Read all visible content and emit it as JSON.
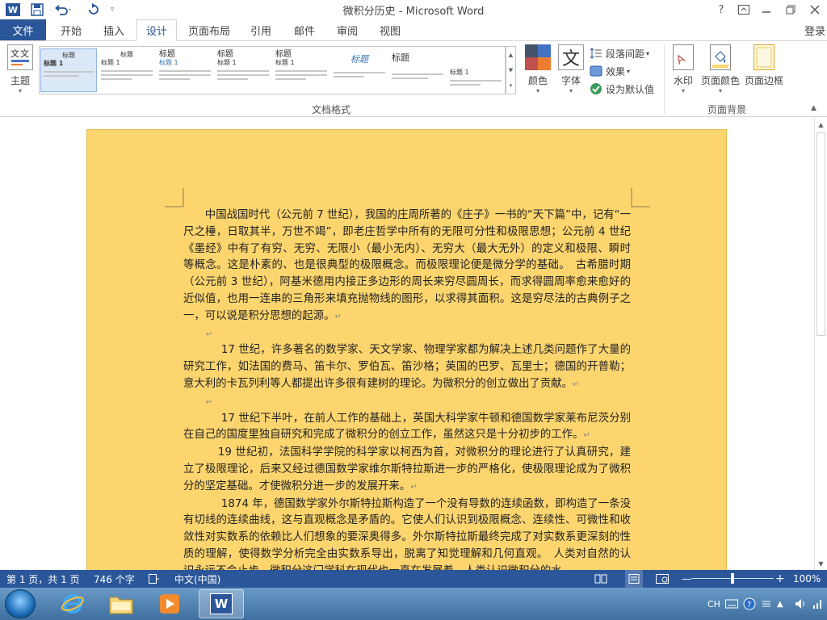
{
  "window": {
    "title": "微积分历史 - Microsoft Word",
    "controls": {
      "help": "?",
      "restore_ribbon": "⊡",
      "minimize": "—",
      "restore": "⧉",
      "close": "✕"
    }
  },
  "quick_access": {
    "app_icon": "W",
    "save_icon": "save-icon",
    "undo_icon": "undo-icon",
    "redo_icon": "redo-icon",
    "customize_icon": "customize-icon"
  },
  "ribbon": {
    "file_tab": "文件",
    "tabs": [
      "开始",
      "插入",
      "设计",
      "页面布局",
      "引用",
      "邮件",
      "审阅",
      "视图"
    ],
    "active_tab": "设计",
    "login": "登录",
    "groups": {
      "document_formatting": {
        "label": "文档格式",
        "theme_label": "主题",
        "styles": [
          {
            "title": "标题",
            "subtitle": "标题 1"
          },
          {
            "title": "标题",
            "subtitle": "标题 1"
          },
          {
            "title": "标题",
            "subtitle": "标题 1"
          },
          {
            "title": "标题",
            "subtitle": "标题 1"
          },
          {
            "title": "标题",
            "subtitle": "标题 1"
          },
          {
            "title": "标题",
            "subtitle": ""
          },
          {
            "title": "标题",
            "subtitle": ""
          },
          {
            "title": "",
            "subtitle": "标题 1"
          },
          {
            "title": "标题",
            "subtitle": ""
          }
        ],
        "colors_label": "颜色",
        "fonts_label": "字体",
        "fonts_glyph": "文",
        "paragraph_spacing_label": "段落间距",
        "effects_label": "效果",
        "set_default_label": "设为默认值"
      },
      "page_background": {
        "label": "页面背景",
        "watermark_label": "水印",
        "page_color_label": "页面颜色",
        "page_borders_label": "页面边框"
      }
    }
  },
  "document": {
    "page_color": "#fdd56e",
    "paragraphs": [
      {
        "text": "中国战国时代（公元前 7 世纪），我国的庄周所著的《庄子》一书的“天下篇”中，记有“一尺之棰，日取其半，万世不竭”，即老庄哲学中所有的无限可分性和极限思想；公元前 4 世纪《墨经》中有了有穷、无穷、无限小（最小无内）、无穷大（最大无外）的定义和极限、瞬时等概念。这是朴素的、也是很典型的极限概念。而极限理论便是微分学的基础。　古希腊时期（公元前 3 世纪），阿基米德用内接正多边形的周长来穷尽圆周长，而求得圆周率愈来愈好的近似值，也用一连串的三角形来填充抛物线的图形，以求得其面积。这是穷尽法的古典例子之一，可以说是积分思想的起源。"
      },
      {
        "text": ""
      },
      {
        "text": "17 世纪，许多著名的数学家、天文学家、物理学家都为解决上述几类问题作了大量的研究工作，如法国的费马、笛卡尔、罗伯瓦、笛沙格；英国的巴罗、瓦里士；德国的开普勒；意大利的卡瓦列利等人都提出许多很有建树的理论。为微积分的创立做出了贡献。"
      },
      {
        "text": ""
      },
      {
        "text": "17 世纪下半叶，在前人工作的基础上，英国大科学家牛顿和德国数学家莱布尼茨分别在自己的国度里独自研究和完成了微积分的创立工作，虽然这只是十分初步的工作。"
      },
      {
        "text": "19 世纪初，法国科学学院的科学家以柯西为首，对微积分的理论进行了认真研究，建立了极限理论，后来又经过德国数学家维尔斯特拉斯进一步的严格化，使极限理论成为了微积分的坚定基础。才使微积分进一步的发展开来。"
      },
      {
        "text": "1874 年，德国数学家外尔斯特拉斯构造了一个没有导数的连续函数，即构造了一条没有切线的连续曲线，这与直观概念是矛盾的。它使人们认识到极限概念、连续性、可微性和收敛性对实数系的依赖比人们想象的要深奥得多。外尔斯特拉斯最终完成了对实数系更深刻的性质的理解，使得数学分析完全由实数系导出，脱离了知觉理解和几何直观。　人类对自然的认识永远不会止步，微积分这门学科在现代也一直在发展着。人类认识微积分的水"
      }
    ],
    "paragraph_mark": "↵"
  },
  "statusbar": {
    "page": "第 1 页，共 1 页",
    "words": "746 个字",
    "language": "中文(中国)",
    "zoom": "100%",
    "zoom_level": 1.0
  },
  "taskbar": {
    "items": [
      "start-icon",
      "internet-explorer-icon",
      "file-explorer-icon",
      "media-player-icon",
      "word-icon"
    ],
    "ime": "CH"
  }
}
